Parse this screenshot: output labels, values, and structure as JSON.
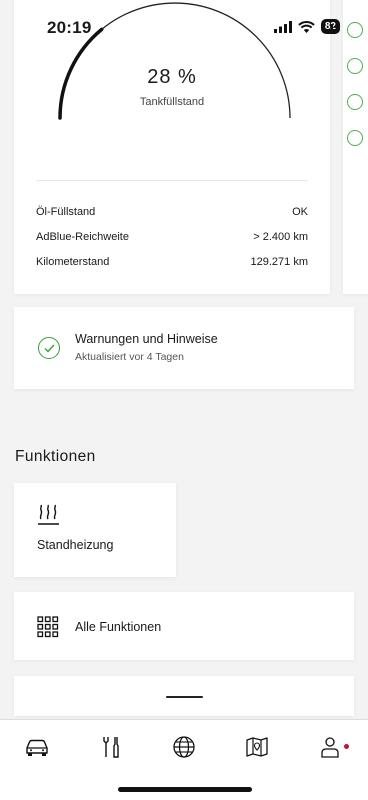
{
  "status_bar": {
    "time": "20:19",
    "battery": "82"
  },
  "gauge": {
    "percent_text": "28 %",
    "fill_fraction": 0.28,
    "label": "Tankfüllstand"
  },
  "vehicle_info": [
    {
      "label": "Öl-Füllstand",
      "value": "OK"
    },
    {
      "label": "AdBlue-Reichweite",
      "value": "> 2.400 km"
    },
    {
      "label": "Kilometerstand",
      "value": "129.271 km"
    }
  ],
  "warnings": {
    "title": "Warnungen und Hinweise",
    "subtitle": "Aktualisiert vor 4 Tagen"
  },
  "functions": {
    "section_title": "Funktionen",
    "heater_label": "Standheizung",
    "all_label": "Alle Funktionen"
  },
  "tab_bar": {
    "tabs": [
      {
        "icon": "car-icon"
      },
      {
        "icon": "tools-icon"
      },
      {
        "icon": "globe-icon"
      },
      {
        "icon": "map-icon"
      },
      {
        "icon": "profile-icon"
      }
    ],
    "accent_color": "#c8102e"
  },
  "colors": {
    "status_ok": "#3a9c3e"
  }
}
